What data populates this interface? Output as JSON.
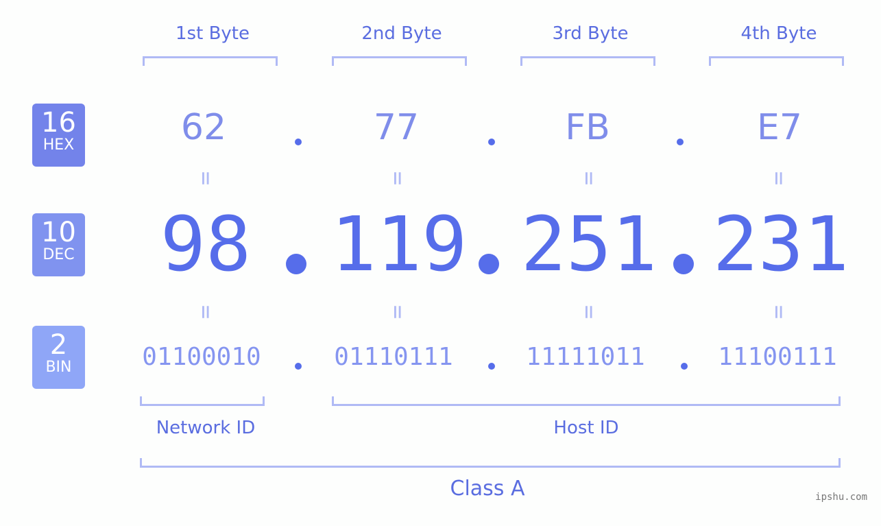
{
  "bytes": {
    "labels": [
      "1st Byte",
      "2nd Byte",
      "3rd Byte",
      "4th Byte"
    ]
  },
  "badges": {
    "hex": {
      "num": "16",
      "label": "HEX",
      "color": "#7383ea"
    },
    "dec": {
      "num": "10",
      "label": "DEC",
      "color": "#8093ef"
    },
    "bin": {
      "num": "2",
      "label": "BIN",
      "color": "#8fa6f7"
    }
  },
  "ip": {
    "hex": [
      "62",
      "77",
      "FB",
      "E7"
    ],
    "dec": [
      "98",
      "119",
      "251",
      "231"
    ],
    "bin": [
      "01100010",
      "01110111",
      "11111011",
      "11100111"
    ],
    "equals": "="
  },
  "segments": {
    "network_id": "Network ID",
    "host_id": "Host ID",
    "class": "Class A"
  },
  "watermark": "ipshu.com",
  "colors": {
    "accent": "#566dea",
    "bracket": "#b0baf5"
  }
}
